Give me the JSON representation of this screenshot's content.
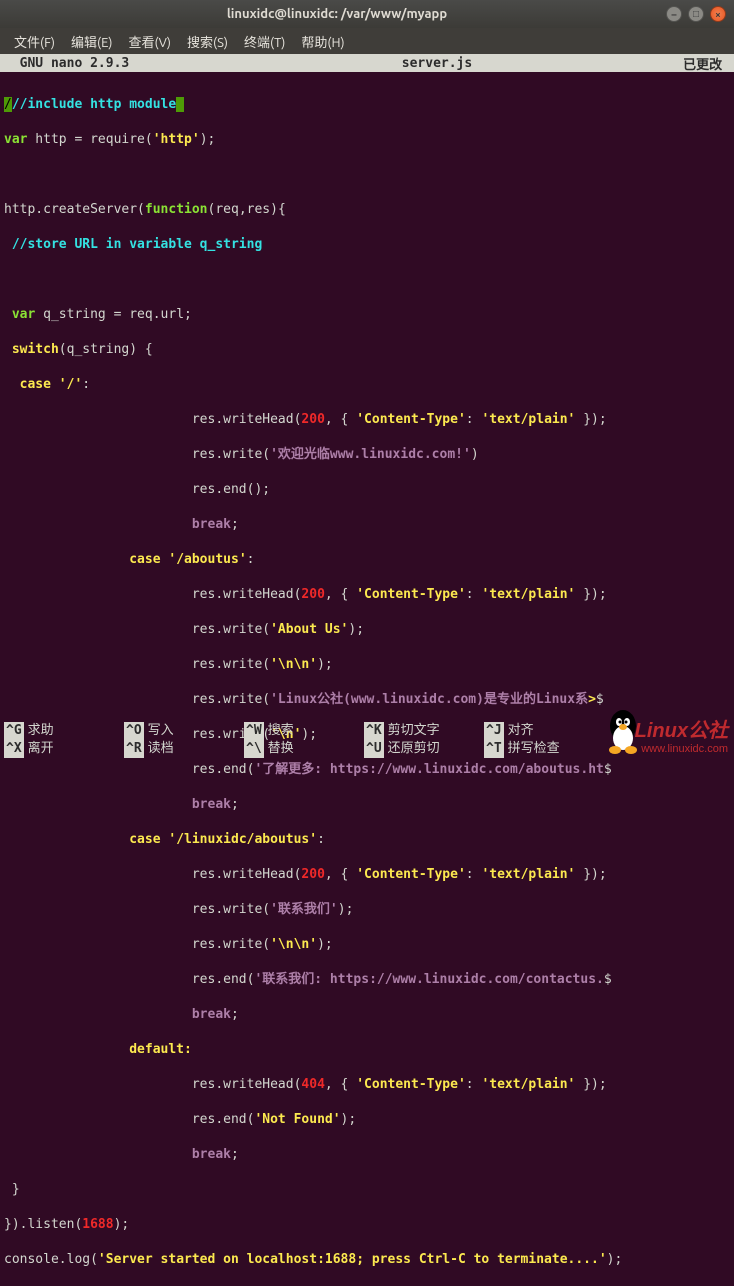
{
  "window": {
    "title": "linuxidc@linuxidc: /var/www/myapp"
  },
  "menu": {
    "file": "文件(F)",
    "edit": "编辑(E)",
    "view": "查看(V)",
    "search": "搜索(S)",
    "terminal": "终端(T)",
    "help": "帮助(H)"
  },
  "nano": {
    "version": "  GNU nano 2.9.3",
    "filename": "server.js",
    "status": "已更改 "
  },
  "code": {
    "l1_comment": "//include http module",
    "l2_var": "var",
    "l2_a": " http = require(",
    "l2_str": "'http'",
    "l2_b": ");",
    "l4_a": "http.createServer(",
    "l4_fn": "function",
    "l4_b": "(req,res){",
    "l5_comment": " //store URL in variable q_string",
    "l7_var": " var",
    "l7_a": " q_string = req.url;",
    "l8_sw": " switch",
    "l8_a": "(q_string) {",
    "l9_case": "  case ",
    "l9_str": "'/'",
    "l9_b": ":",
    "l10_a": "                        res.writeHead(",
    "l10_n": "200",
    "l10_b": ", { ",
    "l10_k": "'Content-Type'",
    "l10_c": ": ",
    "l10_v": "'text/plain'",
    "l10_d": " });",
    "l11_a": "                        res.write(",
    "l11_s": "'欢迎光临www.linuxidc.com!'",
    "l11_b": ")",
    "l12_a": "                        res.end();",
    "l13_a": "                        ",
    "l13_br": "break",
    "l13_b": ";",
    "l14_case": "                case ",
    "l14_str": "'/aboutus'",
    "l14_b": ":",
    "l15_a": "                        res.writeHead(",
    "l15_n": "200",
    "l15_b": ", { ",
    "l15_k": "'Content-Type'",
    "l15_c": ": ",
    "l15_v": "'text/plain'",
    "l15_d": " });",
    "l16_a": "                        res.write(",
    "l16_s": "'About Us'",
    "l16_b": ");",
    "l17_a": "                        res.write(",
    "l17_s": "'\\n\\n'",
    "l17_b": ");",
    "l18_a": "                        res.write(",
    "l18_s": "'Linux公社(www.linuxidc.com)是专业的Linux系",
    "l18_b": ">",
    "l18_c": "$",
    "l19_a": "                        res.write(",
    "l19_s": "'\\n'",
    "l19_b": ");",
    "l20_a": "                        res.end(",
    "l20_s": "'了解更多: https://www.linuxidc.com/aboutus.ht",
    "l20_b": "$",
    "l21_a": "                        ",
    "l21_br": "break",
    "l21_b": ";",
    "l22_case": "                case ",
    "l22_str": "'/linuxidc/aboutus'",
    "l22_b": ":",
    "l23_a": "                        res.writeHead(",
    "l23_n": "200",
    "l23_b": ", { ",
    "l23_k": "'Content-Type'",
    "l23_c": ": ",
    "l23_v": "'text/plain'",
    "l23_d": " });",
    "l24_a": "                        res.write(",
    "l24_s": "'联系我们'",
    "l24_b": ");",
    "l25_a": "                        res.write(",
    "l25_s": "'\\n\\n'",
    "l25_b": ");",
    "l26_a": "                        res.end(",
    "l26_s": "'联系我们: https://www.linuxidc.com/contactus.",
    "l26_b": "$",
    "l27_a": "                        ",
    "l27_br": "break",
    "l27_b": ";",
    "l28_def": "                default:",
    "l29_a": "                        res.writeHead(",
    "l29_n": "404",
    "l29_b": ", { ",
    "l29_k": "'Content-Type'",
    "l29_c": ": ",
    "l29_v": "'text/plain'",
    "l29_d": " });",
    "l30_a": "                        res.end(",
    "l30_s": "'Not Found'",
    "l30_b": ");",
    "l31_a": "                        ",
    "l31_br": "break",
    "l31_b": ";",
    "l32": " }",
    "l33_a": "}).listen(",
    "l33_n": "1688",
    "l33_b": ");",
    "l34_a": "console.log(",
    "l34_s": "'Server started on localhost:1688; press Ctrl-C to terminate....'",
    "l34_b": ");"
  },
  "shortcuts": {
    "r1": {
      "k1": "^G",
      "t1": "求助",
      "k2": "^O",
      "t2": "写入",
      "k3": "^W",
      "t3": "搜索",
      "k4": "^K",
      "t4": "剪切文字",
      "k5": "^J",
      "t5": "对齐"
    },
    "r2": {
      "k1": "^X",
      "t1": "离开",
      "k2": "^R",
      "t2": "读档",
      "k3": "^\\",
      "t3": "替换",
      "k4": "^U",
      "t4": "还原剪切",
      "k5": "^T",
      "t5": "拼写检查"
    }
  },
  "watermark": {
    "main": "Linux公社",
    "sub": "www.linuxidc.com"
  }
}
